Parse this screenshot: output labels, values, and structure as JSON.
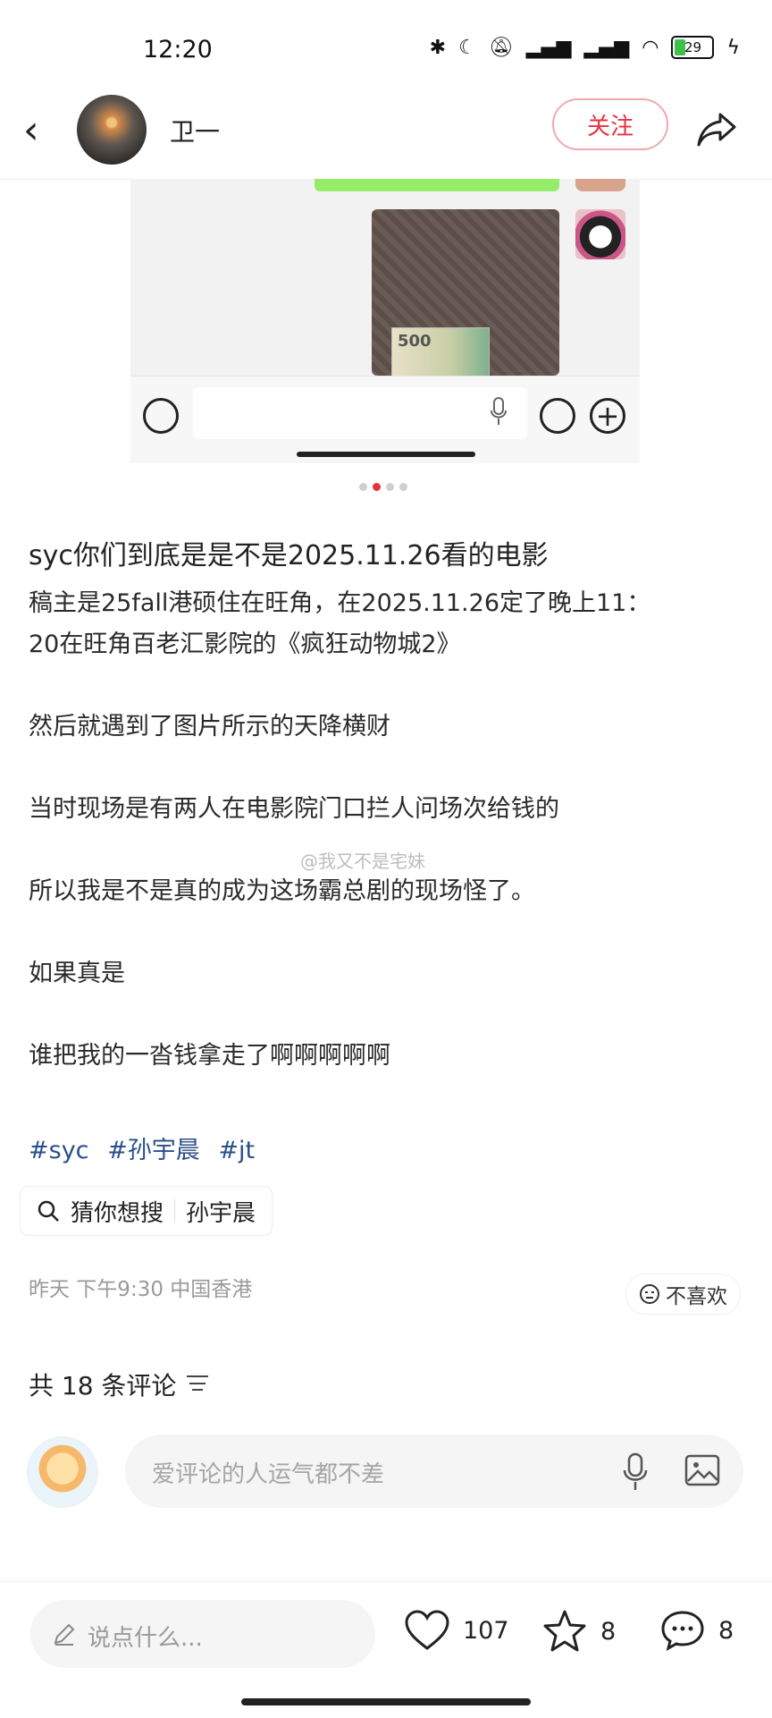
{
  "status_bar": {
    "time": "12:20",
    "battery": "29",
    "icons": [
      "bluetooth-icon",
      "moon-icon",
      "mute-icon",
      "signal-icon",
      "signal-icon",
      "wifi-icon",
      "battery-icon",
      "charging-icon"
    ]
  },
  "header": {
    "author_name": "卫一",
    "follow_label": "关注"
  },
  "image": {
    "banknote_value": "500",
    "page_dots": 4,
    "active_dot": 2
  },
  "post": {
    "title": "syc你们到底是是不是2025.11.26看的电影",
    "paragraphs": [
      "稿主是25fall港硕住在旺角，在2025.11.26定了晚上11：\n20在旺角百老汇影院的《疯狂动物城2》",
      "然后就遇到了图片所示的天降横财",
      "当时现场是有两人在电影院门口拦人问场次给钱的",
      "所以我是不是真的成为这场霸总剧的现场怪了。",
      "如果真是",
      "谁把我的一沓钱拿走了啊啊啊啊啊"
    ],
    "tags": [
      "#syc",
      "#孙宇晨",
      "#jt"
    ],
    "watermark": "@我又不是宅妹"
  },
  "search_suggest": {
    "label": "猜你想搜",
    "term": "孙宇晨"
  },
  "meta": {
    "time_location": "昨天 下午9:30 中国香港",
    "dislike_label": "不喜欢"
  },
  "comments": {
    "count_label": "共 18 条评论",
    "input_placeholder": "爱评论的人运气都不差"
  },
  "bottom_bar": {
    "say_placeholder": "说点什么...",
    "likes": "107",
    "stars": "8",
    "comments": "8"
  },
  "colors": {
    "accent": "#e8323c",
    "tag_blue": "#2b4f8a",
    "wechat_green": "#95ec69"
  }
}
